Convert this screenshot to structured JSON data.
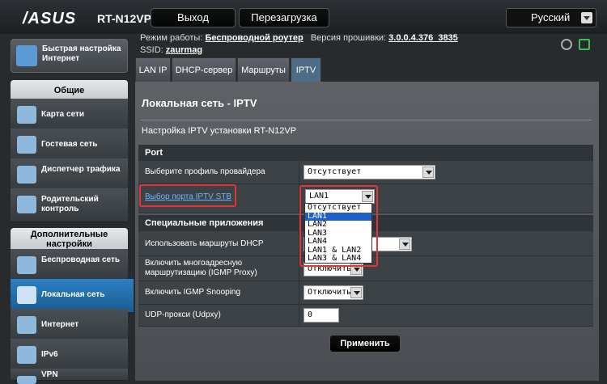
{
  "header": {
    "logo": "/ASUS",
    "model": "RT-N12VP",
    "logout": "Выход",
    "reboot": "Перезагрузка",
    "language": "Русский"
  },
  "status": {
    "mode_label": "Режим работы:",
    "mode_value": "Беспроводной роутер",
    "fw_label": "Версия прошивки:",
    "fw_value": "3.0.0.4.376_3835",
    "ssid_label": "SSID:",
    "ssid_value": "zaurmag"
  },
  "sidebar": {
    "quick_setup": "Быстрая настройка Интернет",
    "group_general": "Общие",
    "items_general": [
      "Карта сети",
      "Гостевая сеть",
      "Диспетчер трафика",
      "Родительский контроль"
    ],
    "group_advanced": "Дополнительные настройки",
    "items_advanced": [
      "Беспроводная сеть",
      "Локальная сеть",
      "Интернет",
      "IPv6",
      "VPN"
    ]
  },
  "tabs": [
    "LAN IP",
    "DHCP-сервер",
    "Маршруты",
    "IPTV"
  ],
  "page": {
    "title": "Локальная сеть - IPTV",
    "description": "Настройка IPTV установки RT-N12VP"
  },
  "port_section": {
    "header": "Port",
    "profile_label": "Выберите профиль провайдера",
    "profile_value": "Отсутствует",
    "stb_label": "Выбор порта IPTV STB",
    "stb_value": "LAN1"
  },
  "dropdown_options": [
    "Отсутствует",
    "LAN1",
    "LAN2",
    "LAN3",
    "LAN4",
    "LAN1 & LAN2",
    "LAN3 & LAN4"
  ],
  "special_section": {
    "header": "Специальные приложения",
    "dhcp_routes_label": "Использовать маршруты DHCP",
    "multicast_label": "Включить многоадресную маршрутизацию (IGMP Proxy)",
    "multicast_value": "Отключить",
    "igmp_label": "Включить IGMP Snooping",
    "igmp_value": "Отключить",
    "udpxy_label": "UDP-прокси (Udpxy)",
    "udpxy_value": "0"
  },
  "apply": "Применить",
  "colors": {
    "highlight": "#1e60c8",
    "active_menu": "#2c7fc2",
    "annotation": "#e0363a"
  }
}
